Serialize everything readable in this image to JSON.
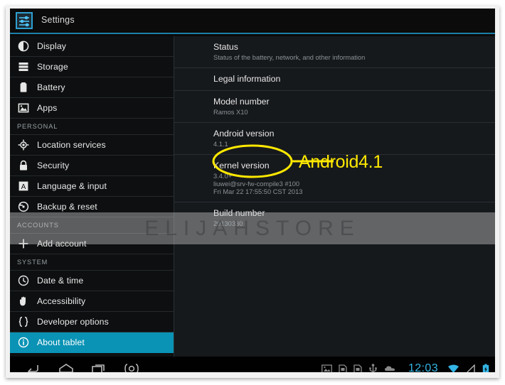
{
  "app": {
    "title": "Settings",
    "icon": "sliders-icon",
    "accent_blue": "#33b5e5",
    "selected_row_color": "#0a93b5"
  },
  "sidebar": {
    "items": [
      {
        "type": "item",
        "id": "display",
        "label": "Display",
        "icon": "brightness-icon",
        "selected": false
      },
      {
        "type": "item",
        "id": "storage",
        "label": "Storage",
        "icon": "storage-icon",
        "selected": false
      },
      {
        "type": "item",
        "id": "battery",
        "label": "Battery",
        "icon": "battery-icon",
        "selected": false
      },
      {
        "type": "item",
        "id": "apps",
        "label": "Apps",
        "icon": "apps-icon",
        "selected": false
      },
      {
        "type": "section",
        "id": "personal",
        "label": "PERSONAL"
      },
      {
        "type": "item",
        "id": "location-services",
        "label": "Location services",
        "icon": "location-icon",
        "selected": false
      },
      {
        "type": "item",
        "id": "security",
        "label": "Security",
        "icon": "lock-icon",
        "selected": false
      },
      {
        "type": "item",
        "id": "language-input",
        "label": "Language & input",
        "icon": "language-a-icon",
        "selected": false
      },
      {
        "type": "item",
        "id": "backup-reset",
        "label": "Backup & reset",
        "icon": "restore-icon",
        "selected": false
      },
      {
        "type": "section",
        "id": "accounts",
        "label": "ACCOUNTS"
      },
      {
        "type": "item",
        "id": "add-account",
        "label": "Add account",
        "icon": "plus-icon",
        "selected": false
      },
      {
        "type": "section",
        "id": "system",
        "label": "SYSTEM"
      },
      {
        "type": "item",
        "id": "date-time",
        "label": "Date & time",
        "icon": "clock-icon",
        "selected": false
      },
      {
        "type": "item",
        "id": "accessibility",
        "label": "Accessibility",
        "icon": "hand-icon",
        "selected": false
      },
      {
        "type": "item",
        "id": "developer-options",
        "label": "Developer options",
        "icon": "braces-icon",
        "selected": false
      },
      {
        "type": "item",
        "id": "about-tablet",
        "label": "About tablet",
        "icon": "info-icon",
        "selected": true
      }
    ]
  },
  "detail": {
    "items": [
      {
        "id": "status",
        "title": "Status",
        "sub": [
          "Status of the battery, network, and other information"
        ]
      },
      {
        "id": "legal-information",
        "title": "Legal information",
        "sub": []
      },
      {
        "id": "model-number",
        "title": "Model number",
        "sub": [
          "Ramos X10"
        ]
      },
      {
        "id": "android-version",
        "title": "Android version",
        "sub": [
          "4.1.1"
        ]
      },
      {
        "id": "kernel-version",
        "title": "Kernel version",
        "sub": [
          "3.4.0+",
          "liuwei@srv-fw-compile3 #100",
          "Fri Mar 22 17:55:50 CST 2013"
        ]
      },
      {
        "id": "build-number",
        "title": "Build number",
        "sub": [
          "20130330"
        ]
      }
    ]
  },
  "annotation": {
    "callout_text": "Android4.1",
    "color": "#ffe800",
    "target": "android-version"
  },
  "watermark": {
    "text": "ELIJAHSTORE"
  },
  "system_bar": {
    "nav_keys": [
      {
        "id": "back",
        "icon": "back-arrow-icon"
      },
      {
        "id": "home",
        "icon": "home-icon"
      },
      {
        "id": "recents",
        "icon": "recents-icon"
      },
      {
        "id": "screenshot",
        "icon": "screenshot-icon"
      }
    ],
    "status_icons": [
      {
        "id": "screenshot-captured",
        "icon": "image-icon"
      },
      {
        "id": "sim-1",
        "icon": "sim-card-icon"
      },
      {
        "id": "sim-2",
        "icon": "sim-card-icon"
      },
      {
        "id": "usb",
        "icon": "usb-icon"
      },
      {
        "id": "adb",
        "icon": "android-debug-icon"
      }
    ],
    "clock": "12:03",
    "right_icons": [
      {
        "id": "wifi",
        "icon": "wifi-icon"
      },
      {
        "id": "signal",
        "icon": "signal-triangle-icon"
      },
      {
        "id": "battery",
        "icon": "battery-status-icon"
      }
    ]
  }
}
